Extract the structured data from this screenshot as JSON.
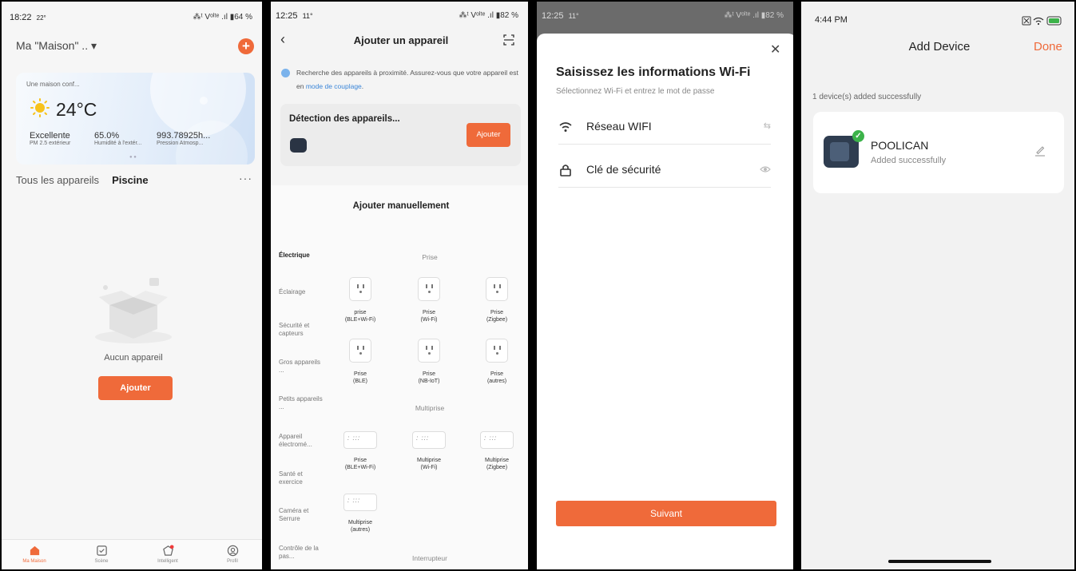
{
  "panel1": {
    "status": {
      "time": "18:22",
      "temp": "22°",
      "right": "⁂ᵗ Vᵒˡᵗᵉ .ıl ▮64 %"
    },
    "home_title": "Ma \"Maison\" .. ▾",
    "weather": {
      "label": "Une maison conf...",
      "temp": "24°C",
      "stats": [
        {
          "value": "Excellente",
          "label": "PM 2.5 extérieur"
        },
        {
          "value": "65.0%",
          "label": "Humidité à l'extér..."
        },
        {
          "value": "993.78925h...",
          "label": "Pression Atmosp..."
        }
      ]
    },
    "tabs": {
      "all": "Tous les appareils",
      "active": "Piscine",
      "more": "···"
    },
    "empty_text": "Aucun appareil",
    "add_label": "Ajouter",
    "nav": [
      "Ma Maison",
      "Scène",
      "Intelligent",
      "Profil"
    ]
  },
  "panel2": {
    "status": {
      "time": "12:25",
      "temp": "11°",
      "right": "⁂ᵗ Vᵒˡᵗᵉ .ıl ▮82 %"
    },
    "title": "Ajouter un appareil",
    "info": "Recherche des appareils à proximité. Assurez-vous que votre appareil est en",
    "info_link": "mode de couplage",
    "info_end": ".",
    "detect_title": "Détection des appareils...",
    "detect_button": "Ajouter",
    "manual_title": "Ajouter manuellement",
    "categories": [
      "Électrique",
      "Éclairage",
      "Sécurité et capteurs",
      "Gros appareils ...",
      "Petits appareils ...",
      "Appareil électromé...",
      "Santé et exercice",
      "Caméra et Serrure",
      "Contrôle de la pas..."
    ],
    "sections": [
      "Prise",
      "Multiprise",
      "Interrupteur"
    ],
    "prise_devices": [
      {
        "l1": "prise",
        "l2": "(BLE+Wi-Fi)"
      },
      {
        "l1": "Prise",
        "l2": "(Wi-Fi)"
      },
      {
        "l1": "Prise",
        "l2": "(Zigbee)"
      },
      {
        "l1": "Prise",
        "l2": "(BLE)"
      },
      {
        "l1": "Prise",
        "l2": "(NB-IoT)"
      },
      {
        "l1": "Prise",
        "l2": "(autres)"
      }
    ],
    "multi_devices": [
      {
        "l1": "Prise",
        "l2": "(BLE+Wi-Fi)"
      },
      {
        "l1": "Multiprise",
        "l2": "(Wi-Fi)"
      },
      {
        "l1": "Multiprise",
        "l2": "(Zigbee)"
      },
      {
        "l1": "Multiprise",
        "l2": "(autres)"
      }
    ]
  },
  "panel3": {
    "status": {
      "time": "12:25",
      "temp": "11°",
      "right": "⁂ᵗ Vᵒˡᵗᵉ .ıl ▮82 %"
    },
    "heading": "Saisissez les informations Wi-Fi",
    "sub": "Sélectionnez Wi-Fi et entrez le mot de passe",
    "wifi_label": "Réseau WIFI",
    "key_label": "Clé de sécurité",
    "next_label": "Suivant"
  },
  "panel4": {
    "time": "4:44 PM",
    "title": "Add Device",
    "done": "Done",
    "count": "1 device(s) added successfully",
    "device_name": "POOLICAN",
    "device_status": "Added successfully"
  },
  "colors": {
    "accent": "#ef6a3a",
    "success": "#3cb34a",
    "link": "#3b86d8"
  }
}
